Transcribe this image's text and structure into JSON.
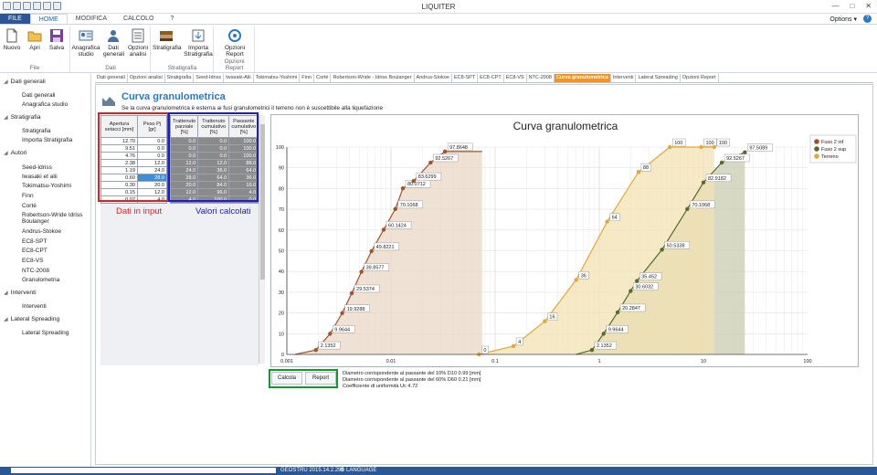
{
  "app": {
    "title": "LIQUITER",
    "options_label": "Options",
    "help_label": "?"
  },
  "ribbon_tabs": [
    "FILE",
    "HOME",
    "MODIFICA",
    "CALCOLO",
    "?"
  ],
  "ribbon": {
    "file_group": {
      "label": "File",
      "buttons": [
        "Nuovo",
        "Apri",
        "Salva"
      ]
    },
    "dati_group": {
      "label": "Dati",
      "buttons": [
        "Anagrafica studio",
        "Dati generali",
        "Opzioni analisi"
      ]
    },
    "strat_group": {
      "label": "Stratigrafia",
      "buttons": [
        "Stratigrafia",
        "Importa Stratigrafia"
      ]
    },
    "report_group": {
      "label": "Opzioni Report",
      "buttons": [
        "Opzioni Report"
      ]
    }
  },
  "nav": {
    "sections": [
      {
        "label": "Dati generali",
        "items": [
          "Dati generali",
          "Anagrafica studio"
        ]
      },
      {
        "label": "Stratigrafia",
        "items": [
          "Stratigrafia",
          "Importa Stratigrafia"
        ]
      },
      {
        "label": "Autori",
        "items": [
          "Seed-Idriss",
          "Iwasaki et alii",
          "Tokimatsu-Yoshimi",
          "Finn",
          "Corté",
          "Robertson-Wride Idriss Boulanger",
          "Andrus-Stokoe",
          "EC8-SPT",
          "EC8-CPT",
          "EC8-VS",
          "NTC-2008",
          "Granulometria"
        ]
      },
      {
        "label": "Interventi",
        "items": [
          "Interventi"
        ]
      },
      {
        "label": "Lateral Spreading",
        "items": [
          "Lateral Spreading"
        ]
      }
    ]
  },
  "subtabs": [
    "Dati generali",
    "Opzioni analisi",
    "Stratigrafia",
    "Seed-Idriss",
    "Iwasaki-Alii",
    "Tokimatsu-Yoshimi",
    "Finn",
    "Corté",
    "Robertson-Wride - Idriss Boulanger",
    "Andrus-Stokoe",
    "EC8-SPT",
    "EC8-CPT",
    "EC8-VS",
    "NTC-2008",
    "Curva granulometrica",
    "Interventi",
    "Lateral Spreading",
    "Opzioni Report"
  ],
  "active_subtab_index": 14,
  "panel": {
    "title": "Curva granulometrica",
    "subtitle": "Se la curva granulometrica è esterna ai fusi granulometrici il terreno non è suscettibile alla liquefazione",
    "input_label": "Dati in input",
    "calc_label": "Valori calcolati"
  },
  "table_input": {
    "headers": [
      "Apertura setacci [mm]",
      "Peso Pj [gr]"
    ],
    "rows": [
      [
        "12.70",
        "0.0"
      ],
      [
        "9.51",
        "0.0"
      ],
      [
        "4.76",
        "0.0"
      ],
      [
        "2.38",
        "12.0"
      ],
      [
        "1.19",
        "24.0"
      ],
      [
        "0.60",
        "28.0"
      ],
      [
        "0.30",
        "20.0"
      ],
      [
        "0.15",
        "12.0"
      ],
      [
        "0.07",
        "4.0"
      ]
    ],
    "selected_row": 5
  },
  "table_calc": {
    "headers": [
      "Trattenuto parziale [%]",
      "Trattenuto cumulativo [%]",
      "Passante cumulativo [%]"
    ],
    "rows": [
      [
        "0.0",
        "0.0",
        "100.0"
      ],
      [
        "0.0",
        "0.0",
        "100.0"
      ],
      [
        "0.0",
        "0.0",
        "100.0"
      ],
      [
        "12.0",
        "12.0",
        "88.0"
      ],
      [
        "24.0",
        "36.0",
        "64.0"
      ],
      [
        "28.0",
        "64.0",
        "36.0"
      ],
      [
        "20.0",
        "84.0",
        "16.0"
      ],
      [
        "12.0",
        "96.0",
        "4.0"
      ],
      [
        "4.0",
        "100.0",
        "0.0"
      ]
    ]
  },
  "buttons": {
    "calcola": "Calcola",
    "report": "Report"
  },
  "results": [
    "Diametro corrispondente al passante del 10% D10 0.99 [mm]",
    "Diametro corrispondente al passante del 60% D60 0.21 [mm]",
    "Coefficiente di uniformità Uc 4.72"
  ],
  "status": {
    "version": "GEOSTRU 2015.14.2.295",
    "language": "LANGUAGE"
  },
  "chart_data": {
    "type": "area",
    "title": "Curva granulometrica",
    "xscale": "log",
    "xlim": [
      0.001,
      100
    ],
    "ylim": [
      0,
      100
    ],
    "x_ticks": [
      "0.001",
      "0.01",
      "0.1",
      "1",
      "10",
      "100"
    ],
    "y_ticks": [
      "0",
      "10",
      "20",
      "30",
      "40",
      "50",
      "60",
      "70",
      "80",
      "90",
      "100"
    ],
    "grid": true,
    "legend": "top-right",
    "series": [
      {
        "name": "Fuso 2 inf",
        "color": "#a0522d",
        "fill": "#e9d7c6",
        "points": [
          [
            0.0012,
            0
          ],
          [
            0.0019,
            2.1352
          ],
          [
            0.0026,
            9.9644
          ],
          [
            0.0034,
            19.9288
          ],
          [
            0.0042,
            29.5374
          ],
          [
            0.0052,
            39.8577
          ],
          [
            0.0065,
            49.8221
          ],
          [
            0.0085,
            60.1424
          ],
          [
            0.011,
            70.1068
          ],
          [
            0.013,
            80.0712
          ],
          [
            0.0165,
            83.6299
          ],
          [
            0.024,
            92.5267
          ],
          [
            0.033,
            97.8648
          ],
          [
            0.075,
            97.8648
          ]
        ],
        "labels": [
          "2.1352",
          "9.9644",
          "19.9288",
          "29.5374",
          "39.8577",
          "49.8221",
          "60.1424",
          "70.1068",
          "80.0712",
          "83.6299",
          "92.5267",
          "97.8648"
        ]
      },
      {
        "name": "Fuso 2 sup",
        "color": "#556b2f",
        "fill": "#c9ccb0",
        "points": [
          [
            0.6,
            0
          ],
          [
            0.85,
            2.1352
          ],
          [
            1.1,
            9.9644
          ],
          [
            1.5,
            20.2847
          ],
          [
            2.0,
            30.6032
          ],
          [
            2.3,
            35.452
          ],
          [
            4.0,
            50.5338
          ],
          [
            7.0,
            70.1068
          ],
          [
            10.0,
            82.9182
          ],
          [
            15.0,
            92.5267
          ],
          [
            25.0,
            97.5089
          ],
          [
            25.0,
            0
          ]
        ],
        "labels": [
          "2.1352",
          "9.9644",
          "20.2847",
          "30.6032",
          "35.452",
          "50.5338",
          "70.1068",
          "82.9182",
          "92.5267",
          "97.5089"
        ]
      },
      {
        "name": "Terreno",
        "color": "#e0a83a",
        "fill": "#f3e2b3",
        "points": [
          [
            0.07,
            0
          ],
          [
            0.15,
            4
          ],
          [
            0.3,
            16
          ],
          [
            0.6,
            36
          ],
          [
            1.19,
            64
          ],
          [
            2.38,
            88
          ],
          [
            4.76,
            100
          ],
          [
            9.51,
            100
          ],
          [
            12.7,
            100
          ]
        ],
        "labels": [
          "0",
          "4",
          "16",
          "36",
          "64",
          "88",
          "100",
          "100",
          "100"
        ]
      }
    ]
  }
}
